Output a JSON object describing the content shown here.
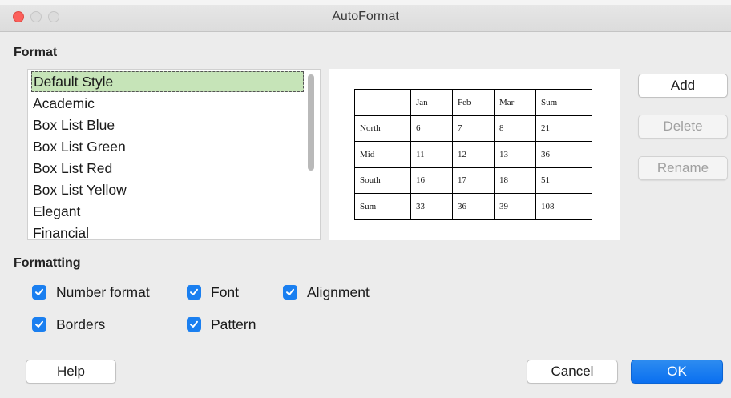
{
  "window": {
    "title": "AutoFormat"
  },
  "format_section": {
    "label": "Format"
  },
  "styles_list": {
    "items": [
      "Default Style",
      "Academic",
      "Box List Blue",
      "Box List Green",
      "Box List Red",
      "Box List Yellow",
      "Elegant",
      "Financial"
    ],
    "selected": "Default Style"
  },
  "preview_table": {
    "rows": [
      [
        "",
        "Jan",
        "Feb",
        "Mar",
        "Sum"
      ],
      [
        "North",
        "6",
        "7",
        "8",
        "21"
      ],
      [
        "Mid",
        "11",
        "12",
        "13",
        "36"
      ],
      [
        "South",
        "16",
        "17",
        "18",
        "51"
      ],
      [
        "Sum",
        "33",
        "36",
        "39",
        "108"
      ]
    ]
  },
  "side_buttons": {
    "add": "Add",
    "delete": "Delete",
    "rename": "Rename"
  },
  "formatting_section": {
    "label": "Formatting",
    "options": {
      "number_format": {
        "label": "Number format",
        "checked": true
      },
      "font": {
        "label": "Font",
        "checked": true
      },
      "alignment": {
        "label": "Alignment",
        "checked": true
      },
      "borders": {
        "label": "Borders",
        "checked": true
      },
      "pattern": {
        "label": "Pattern",
        "checked": true
      }
    }
  },
  "footer_buttons": {
    "help": "Help",
    "cancel": "Cancel",
    "ok": "OK"
  },
  "colors": {
    "accent": "#1a7ff0",
    "selection": "#c6e4b8",
    "close_button": "#fc605b"
  }
}
